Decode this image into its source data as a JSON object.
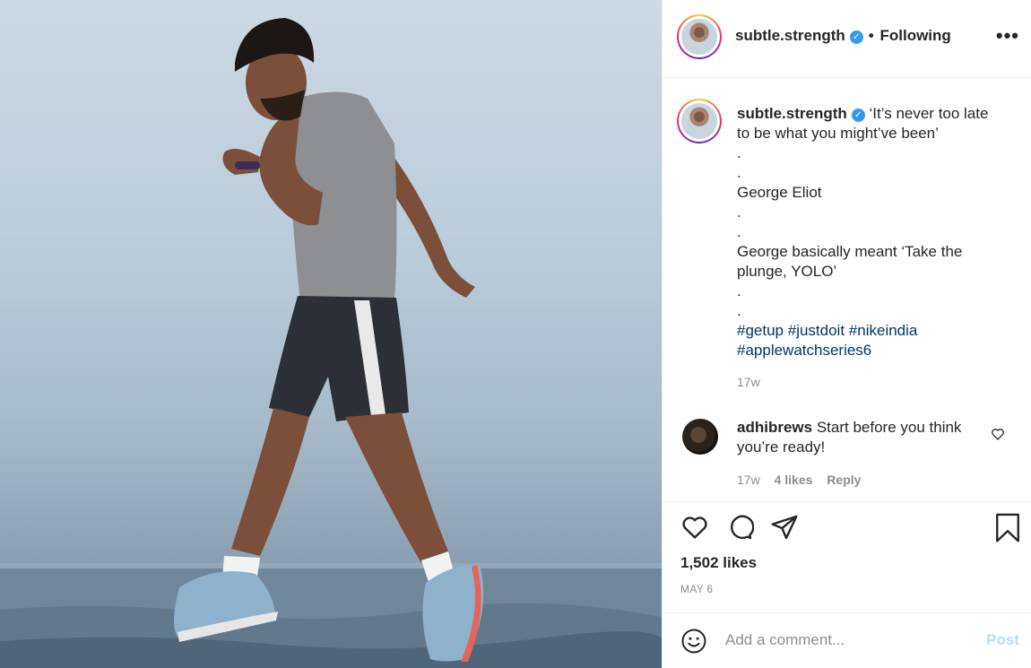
{
  "post": {
    "username": "subtle.strength",
    "follow_status": "Following",
    "verified_icon": "verified-badge-icon",
    "caption_lines": [
      "‘It’s never too late",
      "to be what you might’ve been’",
      ".",
      ".",
      "George Eliot",
      ".",
      ".",
      "George basically meant ‘Take the",
      "plunge, YOLO’",
      ".",
      "."
    ],
    "hashtags_line1": [
      "#getup",
      "#justdoit",
      "#nikeindia"
    ],
    "hashtags_line2": [
      "#applewatchseries6"
    ],
    "caption_time": "17w"
  },
  "comment": {
    "username": "adhibrews",
    "text_line1": "Start before you think",
    "text_line2": "you’re ready!",
    "time": "17w",
    "likes": "4 likes",
    "reply": "Reply"
  },
  "stats": {
    "likes": "1,502 likes",
    "date": "MAY 6"
  },
  "add_comment": {
    "placeholder": "Add a comment...",
    "post_label": "Post"
  },
  "colors": {
    "link": "#00376b",
    "muted": "#8e8e8e",
    "verified": "#3897f0",
    "post_disabled": "#b2dffc"
  }
}
